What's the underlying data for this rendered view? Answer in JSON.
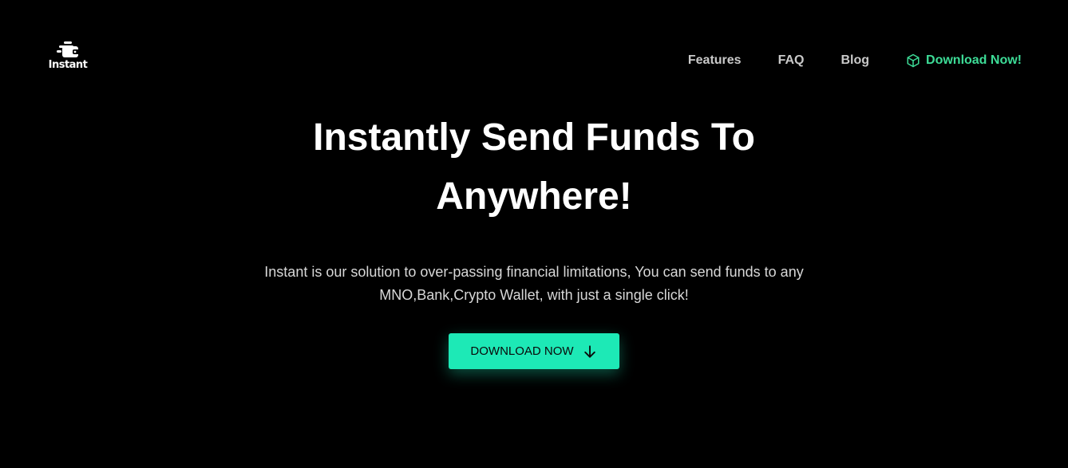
{
  "header": {
    "logo_text": "Instant",
    "logo_icon": "wallet-icon",
    "nav": [
      {
        "label": "Features"
      },
      {
        "label": "FAQ"
      },
      {
        "label": "Blog"
      }
    ],
    "cta": {
      "label": "Download Now!",
      "icon": "box-icon",
      "color": "#3ddc97"
    }
  },
  "hero": {
    "title": "Instantly Send Funds To Anywhere!",
    "subtitle": "Instant is our solution to over-passing financial limitations, You can send funds to any MNO,Bank,Crypto Wallet, with just a single click!",
    "button": {
      "label": "DOWNLOAD NOW",
      "icon": "arrow-down-icon",
      "color": "#1de9b6"
    }
  }
}
